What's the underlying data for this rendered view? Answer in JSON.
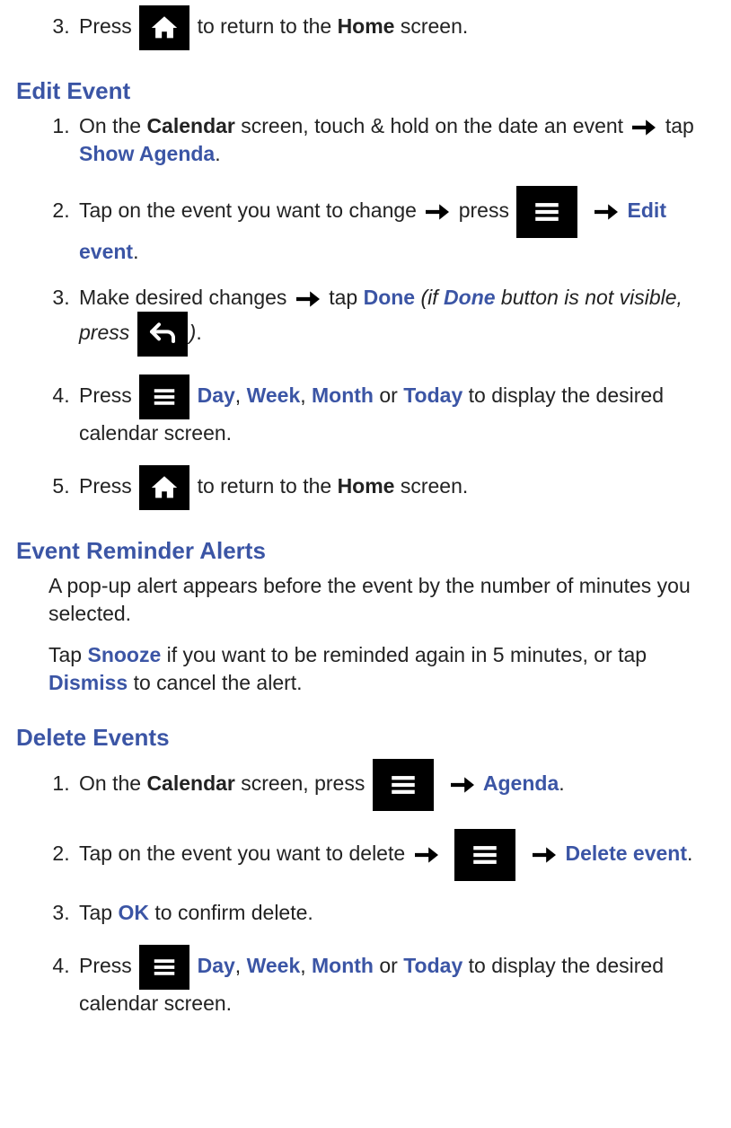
{
  "top": {
    "num": "3.",
    "press": "Press ",
    "rest1": " to return to the ",
    "home": "Home",
    "rest2": " screen."
  },
  "edit": {
    "heading": "Edit Event",
    "s1": {
      "pre": "On the ",
      "cal": "Calendar",
      "mid": " screen, touch & hold on the date an event ",
      "tap": " tap ",
      "show": "Show Agenda",
      "dot": "."
    },
    "s2": {
      "pre": "Tap on the event you want to change ",
      "press": " press ",
      "edit": "Edit event",
      "dot": "."
    },
    "s3": {
      "pre": "Make desired changes ",
      "tap": " tap ",
      "done": "Done",
      "if1": " (if ",
      "done2": "Done",
      "if2": " button is not visible, press ",
      "close": ")",
      "dot": "."
    },
    "s4": {
      "press": "Press ",
      "day": "Day",
      "c1": ", ",
      "week": "Week",
      "c2": ", ",
      "month": "Month",
      "or": " or ",
      "today": "Today",
      "rest": " to display the desired calendar screen."
    },
    "s5": {
      "press": "Press ",
      "rest1": " to return to the ",
      "home": "Home",
      "rest2": " screen."
    }
  },
  "alerts": {
    "heading": "Event Reminder Alerts",
    "p1": "A pop-up alert appears before the event by the number of minutes you selected.",
    "p2a": "Tap ",
    "snooze": "Snooze",
    "p2b": " if you want to be reminded again in 5 minutes, or tap ",
    "dismiss": "Dismiss",
    "p2c": " to cancel the alert."
  },
  "delete": {
    "heading": "Delete Events",
    "s1": {
      "pre": "On the ",
      "cal": "Calendar",
      "mid": " screen, press ",
      "agenda": "Agenda",
      "dot": "."
    },
    "s2": {
      "pre": "Tap on the event you want to delete ",
      "del": "Delete event",
      "dot": "."
    },
    "s3": {
      "pre": "Tap ",
      "ok": "OK",
      "rest": " to confirm delete."
    },
    "s4": {
      "press": "Press ",
      "day": "Day",
      "c1": ", ",
      "week": "Week",
      "c2": ", ",
      "month": "Month",
      "or": " or ",
      "today": "Today",
      "rest": " to display the desired calendar screen."
    }
  }
}
